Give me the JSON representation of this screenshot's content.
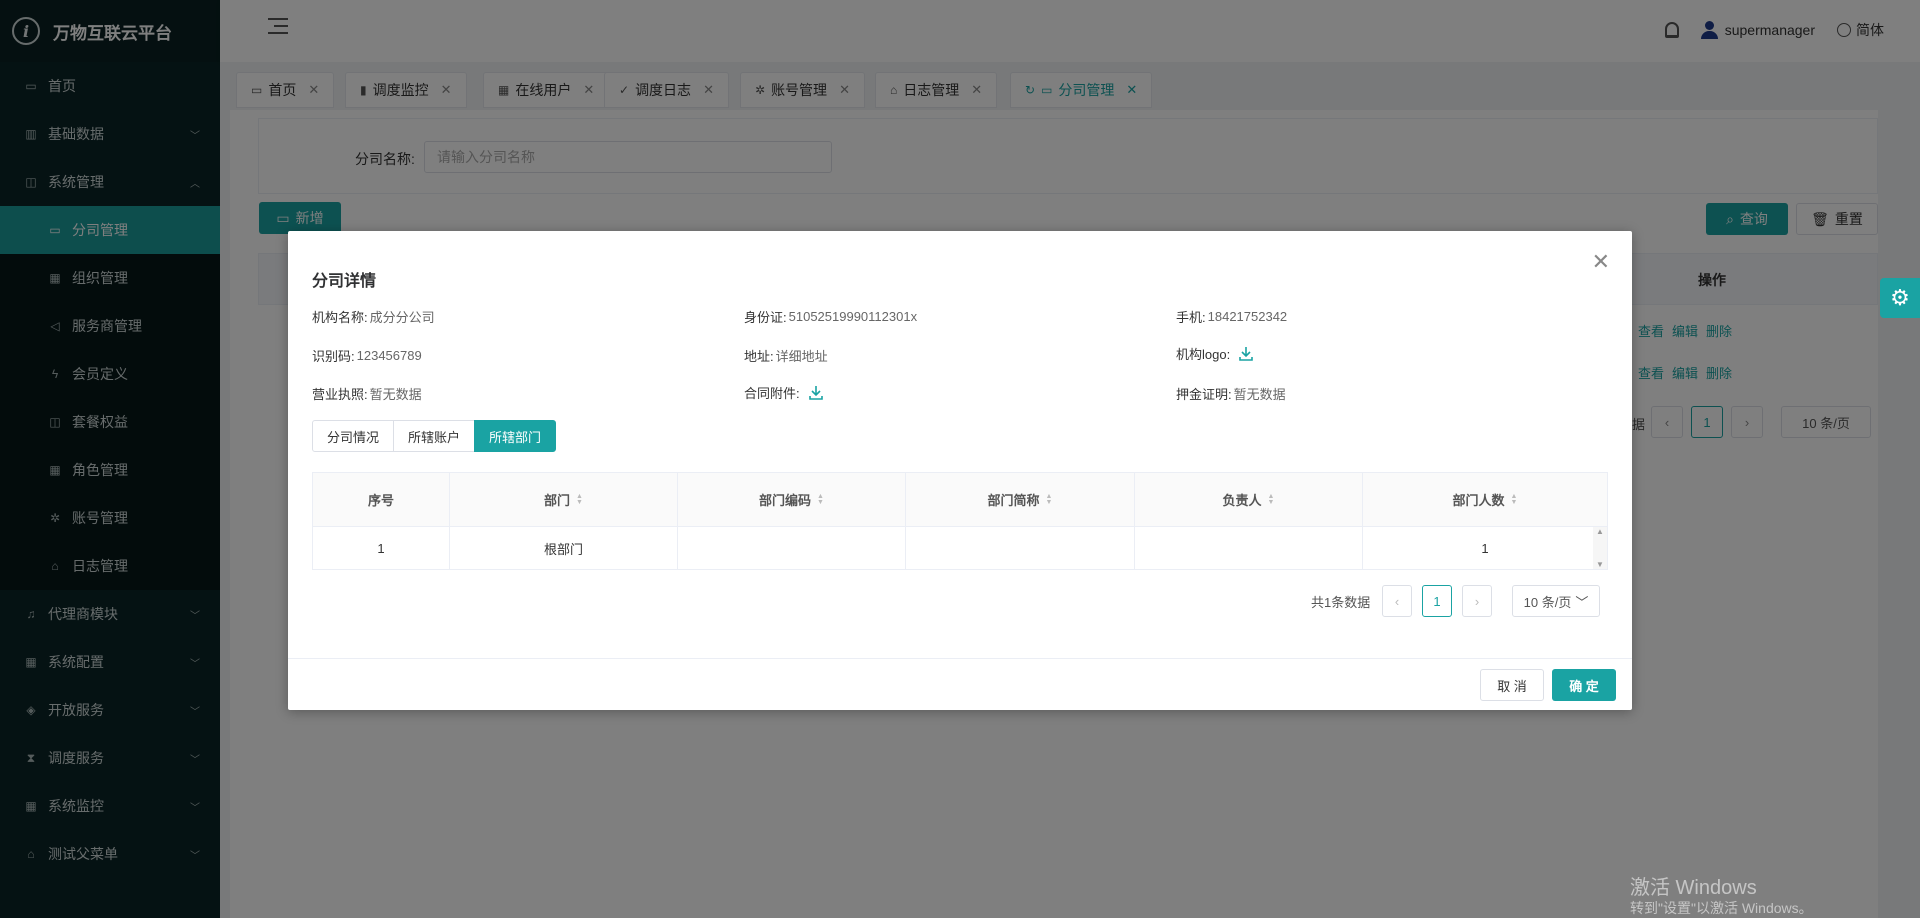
{
  "brand": {
    "title": "万物互联云平台"
  },
  "sidebar": {
    "items": [
      {
        "label": "首页",
        "icon": "calendar-icon"
      },
      {
        "label": "基础数据",
        "icon": "barcode-icon"
      },
      {
        "label": "系统管理",
        "icon": "camera-icon"
      },
      {
        "label": "分司管理",
        "icon": "calendar-icon"
      },
      {
        "label": "组织管理",
        "icon": "grid-icon"
      },
      {
        "label": "服务商管理",
        "icon": "speaker-icon"
      },
      {
        "label": "会员定义",
        "icon": "bolt-icon"
      },
      {
        "label": "套餐权益",
        "icon": "camera-icon"
      },
      {
        "label": "角色管理",
        "icon": "grid-icon"
      },
      {
        "label": "账号管理",
        "icon": "bug-icon"
      },
      {
        "label": "日志管理",
        "icon": "home-icon"
      },
      {
        "label": "代理商模块",
        "icon": "bell-icon"
      },
      {
        "label": "系统配置",
        "icon": "grid-icon"
      },
      {
        "label": "开放服务",
        "icon": "tag-icon"
      },
      {
        "label": "调度服务",
        "icon": "hourglass-icon"
      },
      {
        "label": "系统监控",
        "icon": "grid-icon"
      },
      {
        "label": "测试父菜单",
        "icon": "bank-icon"
      }
    ]
  },
  "header": {
    "username": "supermanager",
    "language": "简体"
  },
  "tabs": [
    {
      "label": "首页"
    },
    {
      "label": "调度监控"
    },
    {
      "label": "在线用户"
    },
    {
      "label": "调度日志"
    },
    {
      "label": "账号管理"
    },
    {
      "label": "日志管理"
    },
    {
      "label": "分司管理"
    }
  ],
  "page": {
    "filter_label": "分司名称:",
    "filter_placeholder": "请输入分司名称",
    "add_label": "新增",
    "search_label": "查询",
    "reset_label": "重置",
    "ops_header": "操作",
    "row_ops": {
      "view": "查看",
      "edit": "编辑",
      "delete": "删除"
    },
    "pager_current": "1",
    "pager_size": "10 条/页",
    "pager_tail": "据"
  },
  "modal": {
    "title": "分司详情",
    "fields": {
      "org_name_label": "机构名称:",
      "org_name": "成分分公司",
      "id_label": "身份证:",
      "id_value": "51052519990112301x",
      "phone_label": "手机:",
      "phone": "18421752342",
      "code_label": "识别码:",
      "code": "123456789",
      "address_label": "地址:",
      "address": "详细地址",
      "logo_label": "机构logo:",
      "license_label": "营业执照:",
      "license": "暂无数据",
      "contract_label": "合同附件:",
      "deposit_label": "押金证明:",
      "deposit": "暂无数据"
    },
    "segments": [
      "分司情况",
      "所辖账户",
      "所辖部门"
    ],
    "active_segment": "所辖部门",
    "table": {
      "columns": [
        "序号",
        "部门",
        "部门编码",
        "部门简称",
        "负责人",
        "部门人数"
      ],
      "rows": [
        [
          "1",
          "根部门",
          "",
          "",
          "",
          "1"
        ]
      ]
    },
    "pager": {
      "total": "共1条数据",
      "current": "1",
      "size": "10 条/页"
    },
    "cancel": "取 消",
    "confirm": "确 定"
  },
  "watermark": {
    "line1": "激活 Windows",
    "line2": "转到\"设置\"以激活 Windows。"
  },
  "colors": {
    "accent": "#1aa3a3",
    "sidebar_bg": "#0b2526"
  }
}
